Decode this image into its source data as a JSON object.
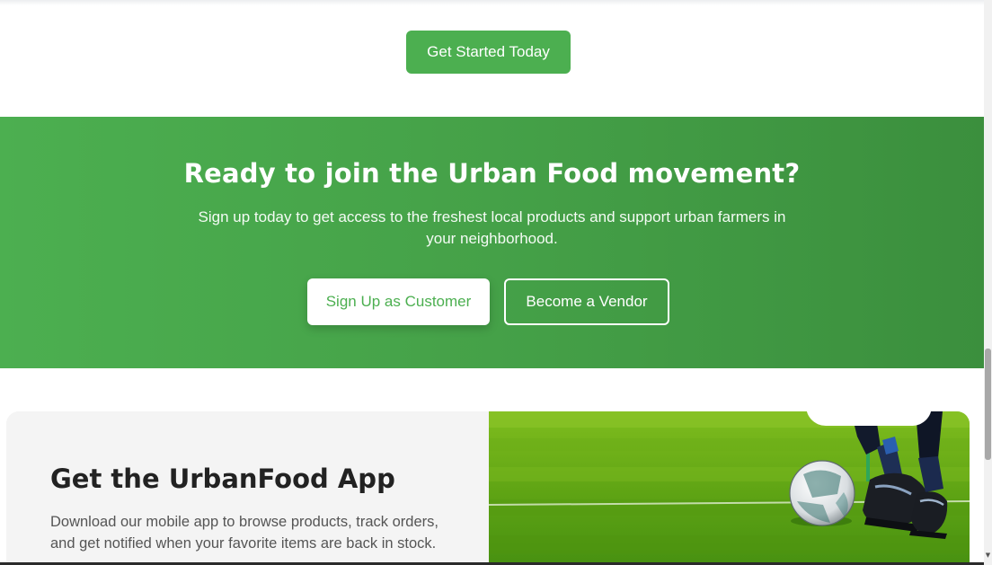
{
  "top": {
    "get_started_label": "Get Started Today"
  },
  "cta": {
    "title": "Ready to join the Urban Food movement?",
    "description": "Sign up today to get access to the freshest local products and support urban farmers in your neighborhood.",
    "customer_button_label": "Sign Up as Customer",
    "vendor_button_label": "Become a Vendor"
  },
  "app": {
    "title": "Get the UrbanFood App",
    "description": "Download our mobile app to browse products, track orders, and get notified when your favorite items are back in stock."
  },
  "colors": {
    "brand_green": "#4caf50",
    "cta_gradient_end": "#3b8f3d",
    "card_bg": "#f4f4f4"
  },
  "icons": {
    "scroll_down": "scroll-down-arrow-icon"
  }
}
